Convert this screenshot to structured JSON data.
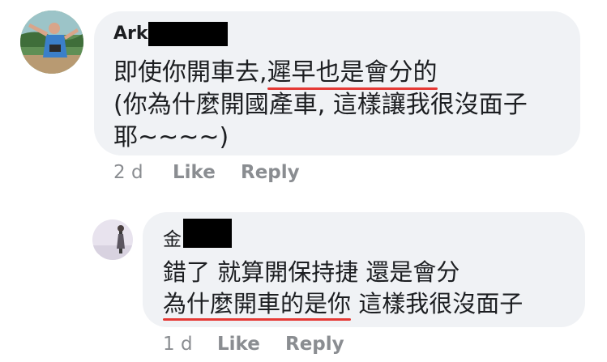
{
  "comments": [
    {
      "author": "Ark",
      "line1_plain": "即使你開車去,",
      "line1_underlined": "遲早也是會分的",
      "line2": "(你為什麼開國產車, 這樣讓我很沒面子",
      "line3": "耶~~~~)",
      "time": "2 d",
      "like_label": "Like",
      "reply_label": "Reply"
    },
    {
      "author": "金",
      "line1": "錯了 就算開保持捷 還是會分",
      "line2_underlined": "為什麼開車的是你",
      "line2_plain": " 這樣我很沒面子",
      "time": "1 d",
      "like_label": "Like",
      "reply_label": "Reply"
    }
  ],
  "colors": {
    "bubble": "#f0f2f5",
    "text": "#1c1e21",
    "meta": "#8a8d91",
    "underline": "#e53935",
    "redaction": "#000000"
  }
}
